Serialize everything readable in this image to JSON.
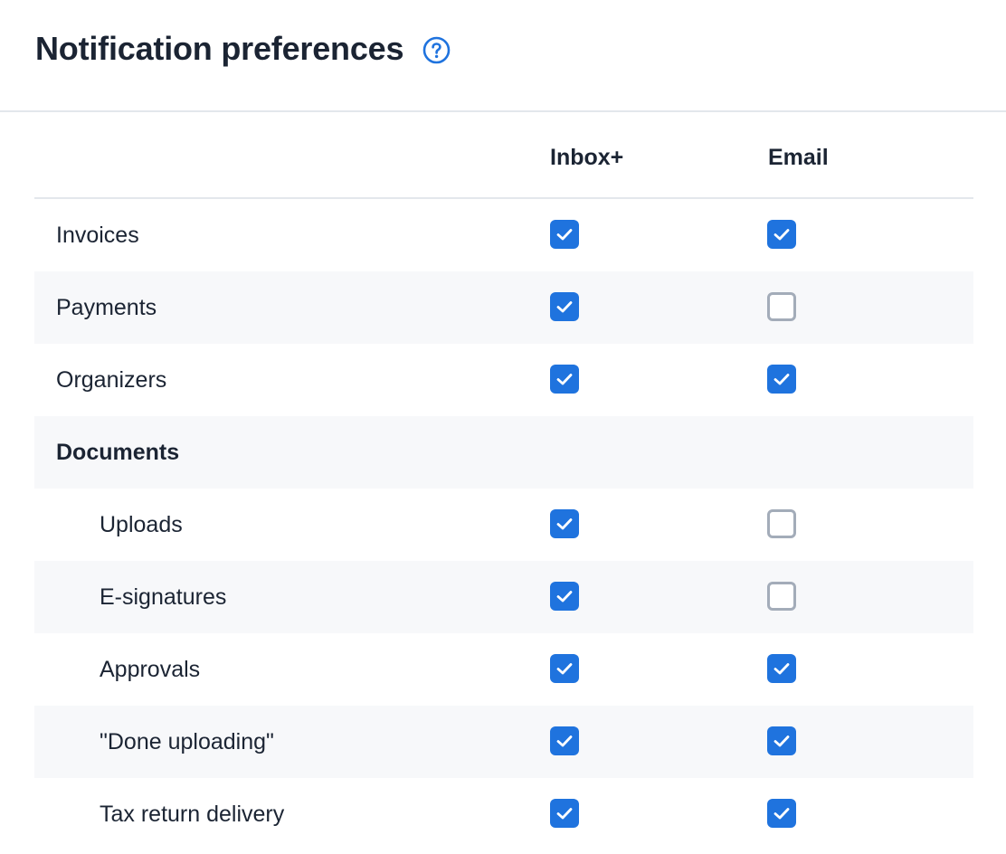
{
  "header": {
    "title": "Notification preferences",
    "help_icon": "question-circle-icon"
  },
  "colors": {
    "accent": "#1f73de",
    "unchecked_border": "#a3acb9",
    "row_shade": "#f7f8fa",
    "divider": "#e3e7ec"
  },
  "table": {
    "columns": [
      "Inbox+",
      "Email"
    ],
    "rows": [
      {
        "label": "Invoices",
        "kind": "item",
        "inbox": true,
        "email": true
      },
      {
        "label": "Payments",
        "kind": "item",
        "inbox": true,
        "email": false
      },
      {
        "label": "Organizers",
        "kind": "item",
        "inbox": true,
        "email": true
      },
      {
        "label": "Documents",
        "kind": "group"
      },
      {
        "label": "Uploads",
        "kind": "sub",
        "inbox": true,
        "email": false
      },
      {
        "label": "E-signatures",
        "kind": "sub",
        "inbox": true,
        "email": false
      },
      {
        "label": "Approvals",
        "kind": "sub",
        "inbox": true,
        "email": true
      },
      {
        "label": "\"Done uploading\"",
        "kind": "sub",
        "inbox": true,
        "email": true
      },
      {
        "label": "Tax return delivery",
        "kind": "sub",
        "inbox": true,
        "email": true
      }
    ]
  }
}
